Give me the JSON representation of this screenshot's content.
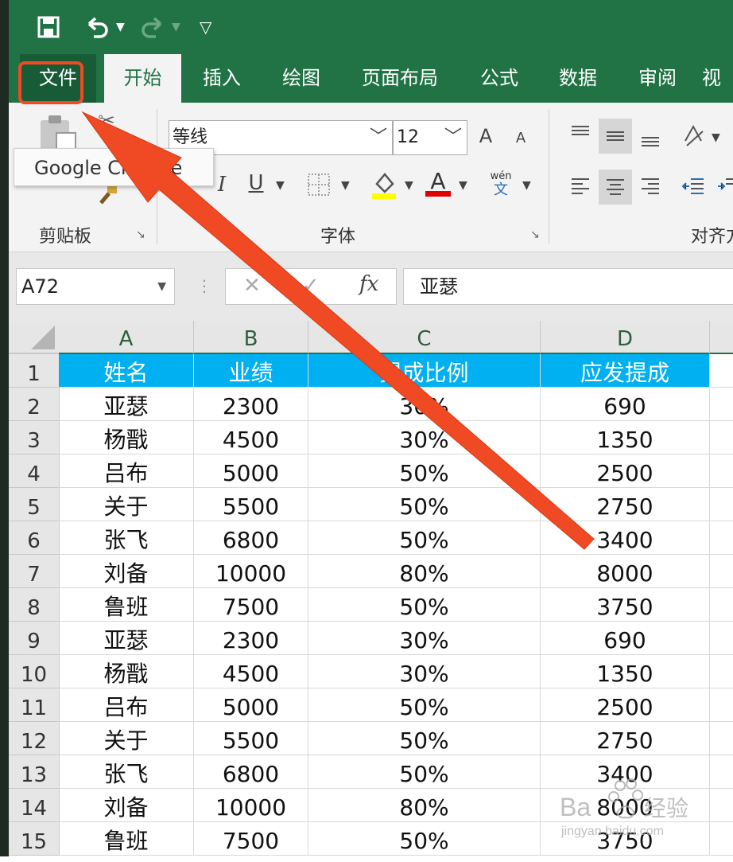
{
  "quick_access": {
    "save_icon": "save-icon",
    "undo_icon": "undo-icon",
    "redo_icon": "redo-icon",
    "customize_icon": "customize-icon"
  },
  "tabs": [
    {
      "label": "文件"
    },
    {
      "label": "开始"
    },
    {
      "label": "插入"
    },
    {
      "label": "绘图"
    },
    {
      "label": "页面布局"
    },
    {
      "label": "公式"
    },
    {
      "label": "数据"
    },
    {
      "label": "审阅"
    },
    {
      "label": "视"
    }
  ],
  "ribbon": {
    "clipboard_label": "剪贴板",
    "font_label": "字体",
    "align_label": "对齐方",
    "font_name": "等线",
    "font_size": "12",
    "italic": "I",
    "underline": "U",
    "increase_font": "A",
    "decrease_font": "A",
    "font_color_a": "A",
    "phonetic_top": "wén",
    "phonetic_bottom": "文"
  },
  "tooltip": "Google Chrome",
  "formula_bar": {
    "name_box": "A72",
    "fx": "fx",
    "content": "亚瑟"
  },
  "columns": [
    "A",
    "B",
    "C",
    "D"
  ],
  "header_row": [
    "姓名",
    "业绩",
    "提成比例",
    "应发提成"
  ],
  "rows": [
    {
      "num": "1"
    },
    {
      "num": "2",
      "cells": [
        "亚瑟",
        "2300",
        "30%",
        "690"
      ]
    },
    {
      "num": "3",
      "cells": [
        "杨戬",
        "4500",
        "30%",
        "1350"
      ]
    },
    {
      "num": "4",
      "cells": [
        "吕布",
        "5000",
        "50%",
        "2500"
      ]
    },
    {
      "num": "5",
      "cells": [
        "关于",
        "5500",
        "50%",
        "2750"
      ]
    },
    {
      "num": "6",
      "cells": [
        "张飞",
        "6800",
        "50%",
        "3400"
      ]
    },
    {
      "num": "7",
      "cells": [
        "刘备",
        "10000",
        "80%",
        "8000"
      ]
    },
    {
      "num": "8",
      "cells": [
        "鲁班",
        "7500",
        "50%",
        "3750"
      ]
    },
    {
      "num": "9",
      "cells": [
        "亚瑟",
        "2300",
        "30%",
        "690"
      ]
    },
    {
      "num": "10",
      "cells": [
        "杨戬",
        "4500",
        "30%",
        "1350"
      ]
    },
    {
      "num": "11",
      "cells": [
        "吕布",
        "5000",
        "50%",
        "2500"
      ]
    },
    {
      "num": "12",
      "cells": [
        "关于",
        "5500",
        "50%",
        "2750"
      ]
    },
    {
      "num": "13",
      "cells": [
        "张飞",
        "6800",
        "50%",
        "3400"
      ]
    },
    {
      "num": "14",
      "cells": [
        "刘备",
        "10000",
        "80%",
        "8000"
      ]
    },
    {
      "num": "15",
      "cells": [
        "鲁班",
        "7500",
        "50%",
        "3750"
      ]
    }
  ],
  "colors": {
    "excel_green": "#217346",
    "header_fill": "#00b0f0",
    "annotation": "#f04a24",
    "font_color_bar": "#e00000",
    "highlight_bar": "#ffff00"
  }
}
